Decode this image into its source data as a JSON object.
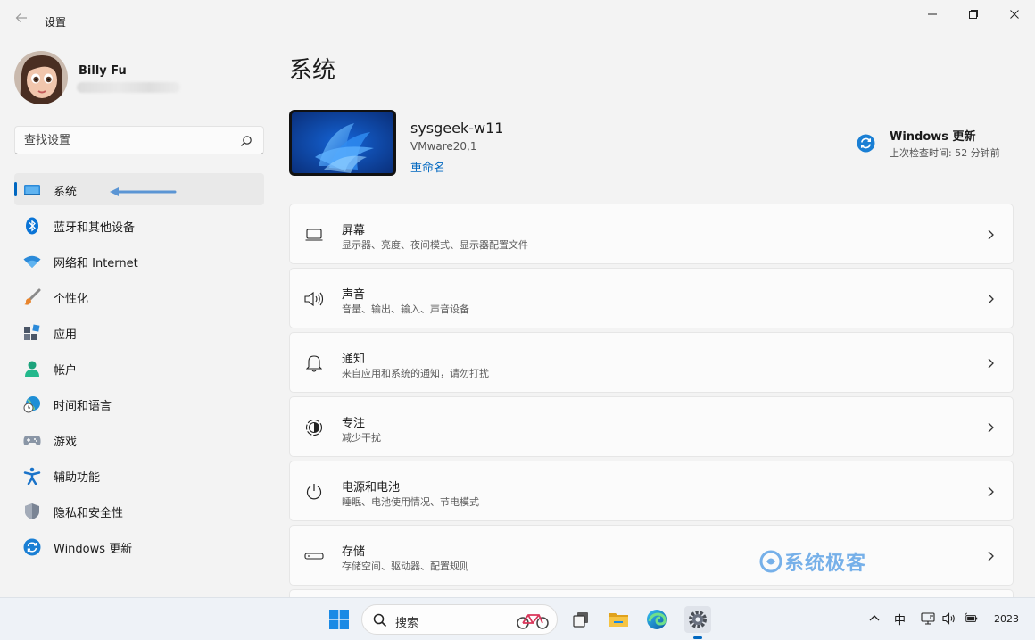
{
  "window": {
    "title": "设置",
    "back_icon": "back-arrow-icon",
    "controls": [
      "minimize-icon",
      "maximize-icon",
      "close-icon"
    ]
  },
  "user": {
    "name": "Billy Fu"
  },
  "search": {
    "placeholder": "查找设置",
    "icon": "search-icon"
  },
  "sidebar": {
    "items": [
      {
        "label": "系统",
        "icon": "display-icon",
        "active": true
      },
      {
        "label": "蓝牙和其他设备",
        "icon": "bluetooth-icon"
      },
      {
        "label": "网络和 Internet",
        "icon": "wifi-icon"
      },
      {
        "label": "个性化",
        "icon": "brush-icon"
      },
      {
        "label": "应用",
        "icon": "apps-icon"
      },
      {
        "label": "帐户",
        "icon": "person-icon"
      },
      {
        "label": "时间和语言",
        "icon": "globe-clock-icon"
      },
      {
        "label": "游戏",
        "icon": "gamepad-icon"
      },
      {
        "label": "辅助功能",
        "icon": "accessibility-icon"
      },
      {
        "label": "隐私和安全性",
        "icon": "shield-icon"
      },
      {
        "label": "Windows 更新",
        "icon": "update-icon"
      }
    ]
  },
  "main": {
    "title": "系统",
    "device": {
      "name": "sysgeek-w11",
      "model": "VMware20,1",
      "rename_label": "重命名"
    },
    "update": {
      "title": "Windows 更新",
      "subtitle": "上次检查时间: 52 分钟前",
      "icon": "sync-icon"
    },
    "cards": [
      {
        "title": "屏幕",
        "subtitle": "显示器、亮度、夜间模式、显示器配置文件",
        "icon": "monitor-icon"
      },
      {
        "title": "声音",
        "subtitle": "音量、输出、输入、声音设备",
        "icon": "speaker-icon"
      },
      {
        "title": "通知",
        "subtitle": "来自应用和系统的通知，请勿打扰",
        "icon": "bell-icon"
      },
      {
        "title": "专注",
        "subtitle": "减少干扰",
        "icon": "focus-icon"
      },
      {
        "title": "电源和电池",
        "subtitle": "睡眠、电池使用情况、节电模式",
        "icon": "power-icon"
      },
      {
        "title": "存储",
        "subtitle": "存储空间、驱动器、配置规则",
        "icon": "storage-icon"
      }
    ]
  },
  "watermark": "系统极客",
  "taskbar": {
    "search_label": "搜索",
    "apps": [
      "start-icon",
      "task-view-icon",
      "file-explorer-icon",
      "edge-icon",
      "settings-icon"
    ],
    "tray": {
      "ime": "中",
      "year": "2023"
    }
  },
  "colors": {
    "accent": "#0067c0",
    "background": "#f3f3f3",
    "card": "#fbfbfb"
  }
}
